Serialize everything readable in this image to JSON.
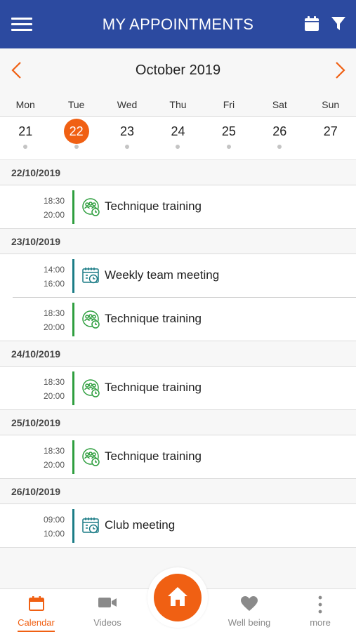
{
  "header": {
    "title": "MY APPOINTMENTS",
    "menu_icon": "hamburger-icon",
    "calendar_icon": "calendar-icon",
    "filter_icon": "filter-icon",
    "color": "#2c4aa0"
  },
  "month": {
    "label": "October 2019",
    "accent": "#f06013"
  },
  "weekdays": [
    "Mon",
    "Tue",
    "Wed",
    "Thu",
    "Fri",
    "Sat",
    "Sun"
  ],
  "days": [
    {
      "num": "21",
      "dot": true,
      "selected": false
    },
    {
      "num": "22",
      "dot": true,
      "selected": true
    },
    {
      "num": "23",
      "dot": true,
      "selected": false
    },
    {
      "num": "24",
      "dot": true,
      "selected": false
    },
    {
      "num": "25",
      "dot": true,
      "selected": false
    },
    {
      "num": "26",
      "dot": true,
      "selected": false
    },
    {
      "num": "27",
      "dot": false,
      "selected": false
    }
  ],
  "groups": [
    {
      "date": "22/10/2019",
      "items": [
        {
          "start": "18:30",
          "end": "20:00",
          "title": "Technique training",
          "type": "training"
        }
      ]
    },
    {
      "date": "23/10/2019",
      "items": [
        {
          "start": "14:00",
          "end": "16:00",
          "title": "Weekly team meeting",
          "type": "meeting"
        },
        {
          "start": "18:30",
          "end": "20:00",
          "title": "Technique training",
          "type": "training"
        }
      ]
    },
    {
      "date": "24/10/2019",
      "items": [
        {
          "start": "18:30",
          "end": "20:00",
          "title": "Technique training",
          "type": "training"
        }
      ]
    },
    {
      "date": "25/10/2019",
      "items": [
        {
          "start": "18:30",
          "end": "20:00",
          "title": "Technique training",
          "type": "training"
        }
      ]
    },
    {
      "date": "26/10/2019",
      "items": [
        {
          "start": "09:00",
          "end": "10:00",
          "title": "Club meeting",
          "type": "meeting"
        }
      ]
    }
  ],
  "type_colors": {
    "training": "#2e9e3e",
    "meeting": "#1b7c86"
  },
  "tabs": [
    {
      "id": "calendar",
      "label": "Calendar",
      "icon": "calendar-icon",
      "active": true
    },
    {
      "id": "videos",
      "label": "Videos",
      "icon": "video-camera-icon",
      "active": false
    },
    {
      "id": "home",
      "label": "",
      "icon": "home-icon",
      "active": false
    },
    {
      "id": "wellbeing",
      "label": "Well being",
      "icon": "heart-icon",
      "active": false
    },
    {
      "id": "more",
      "label": "more",
      "icon": "more-vertical-icon",
      "active": false
    }
  ]
}
